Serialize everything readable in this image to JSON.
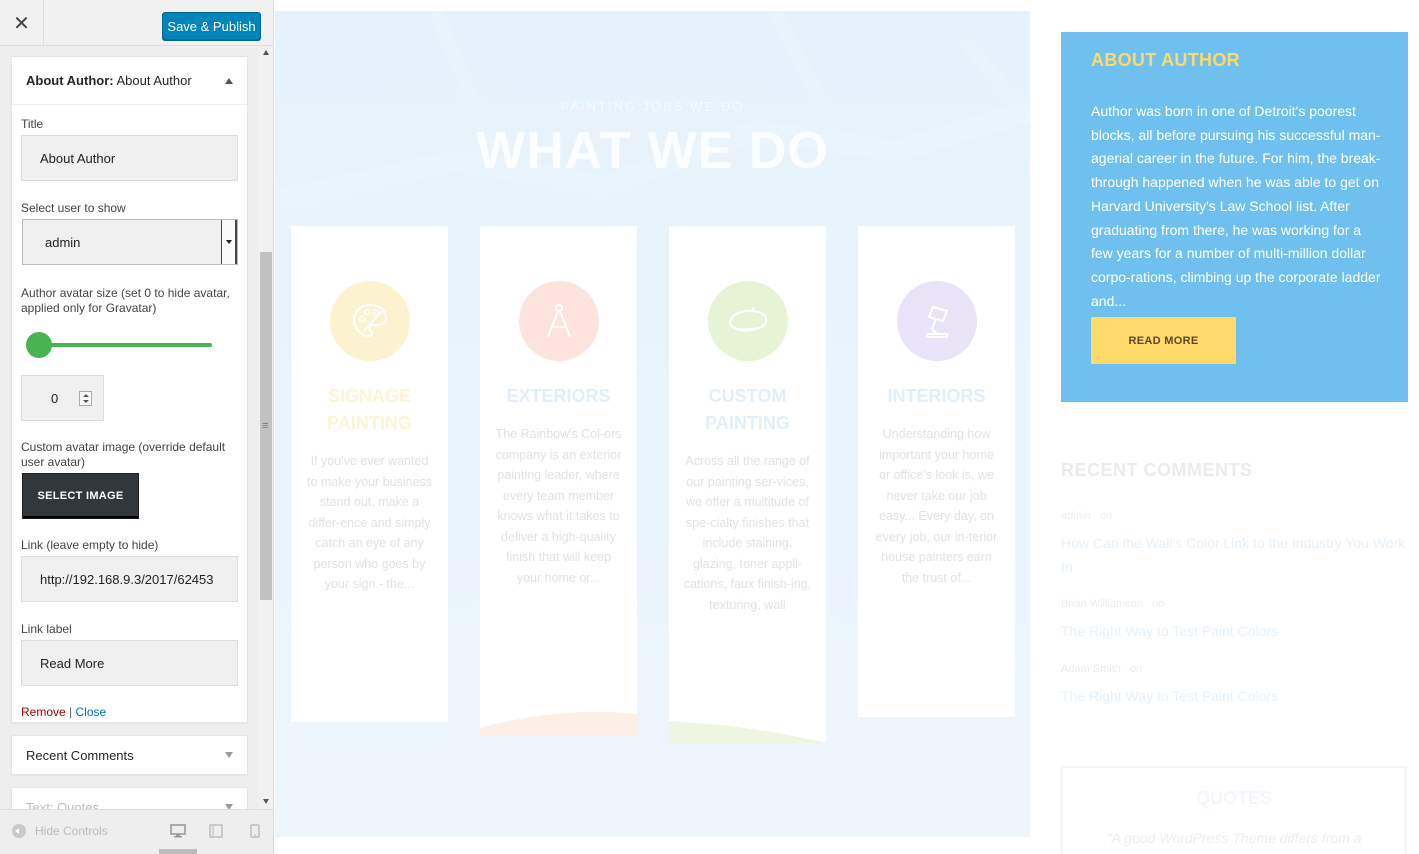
{
  "customizer": {
    "close_glyph": "✕",
    "publish_label": "Save & Publish",
    "widget_open": {
      "prefix": "About Author:",
      "name": " About Author",
      "title_label": "Title",
      "title_value": "About Author",
      "user_label": "Select user to show",
      "user_value": "admin",
      "avatar_size_label": "Author avatar size (set 0 to hide avatar, applied only for Gravatar)",
      "avatar_size_value": "0",
      "avatar_size_slider_level": 0,
      "custom_avatar_label": "Custom avatar image (override default user avatar)",
      "select_image_label": "SELECT IMAGE",
      "link_label": "Link (leave empty to hide)",
      "link_value": "http://192.168.9.3/2017/62453",
      "link_label_label": "Link label",
      "link_label_value": "Read More",
      "remove_label": "Remove",
      "separator": "|",
      "close_label": "Close"
    },
    "widget_recent": "Recent Comments",
    "widget_quotes": "Text: Quotes",
    "hide_controls": "Hide Controls",
    "devices": [
      "desktop-icon",
      "tablet-icon",
      "mobile-icon"
    ]
  },
  "hero": {
    "kicker": "PAINTING JOBS WE DO",
    "title": "WHAT WE DO"
  },
  "services": [
    {
      "title": "SIGNAGE PAINTING",
      "text": "If you've ever wanted to make your business stand out, make a differ-ence and simply catch an eye of any person who goes by your sign - the...",
      "color": "#fdf2cf",
      "title_color": "#fdf3d5",
      "icon": "palette-icon"
    },
    {
      "title": "EXTERIORS",
      "text": "The Rainbow's Col-ors company is an exterior painting leader, where every team member knows what it takes to deliver a high-quality finish that will keep your home or...",
      "color": "#fce4dc",
      "title_color": "#e1effb",
      "icon": "compass-icon"
    },
    {
      "title": "CUSTOM PAINTING",
      "text": "Across all the range of our painting ser-vices, we offer a multitude of spe-cialty finishes that include staining, glazing, toner appli-cations, faux finish-ing, texturing, wall",
      "color": "#e7f3d5",
      "title_color": "#e1effb",
      "icon": "beret-icon"
    },
    {
      "title": "INTERIORS",
      "text": "Understanding how important your home or office's look is, we never take our job easy... Every day, on every job, our in-terior house painters earn the trust of...",
      "color": "#e9e3f7",
      "title_color": "#e1effb",
      "icon": "lamp-icon"
    }
  ],
  "about": {
    "title": "ABOUT AUTHOR",
    "text": "Author was born in one of Detroit's poorest blocks, all before pursuing his successful man-agerial career in the future. For him, the break-through happened when he was able to get on Harvard University's Law School list. After graduating from there, he was working for a few years for a number of multi-million dollar corpo-rations, climbing up the corporate ladder and...",
    "button": "READ MORE",
    "bg_color": "#6fc0ee",
    "accent_color": "#ffd969"
  },
  "recent_comments": {
    "title": "RECENT COMMENTS",
    "items": [
      {
        "author": "admin",
        "on": "on",
        "post": "How Can the Wall's Color Link to the Industry You Work In"
      },
      {
        "author": "Brian Williamson",
        "on": "on",
        "post": "The Right Way to Test Paint Colors"
      },
      {
        "author": "Adam Smith",
        "on": "on",
        "post": "The Right Way to Test Paint Colors"
      }
    ]
  },
  "quotes": {
    "title": "QUOTES",
    "text": "\"A good WordPress Theme differs from a"
  }
}
